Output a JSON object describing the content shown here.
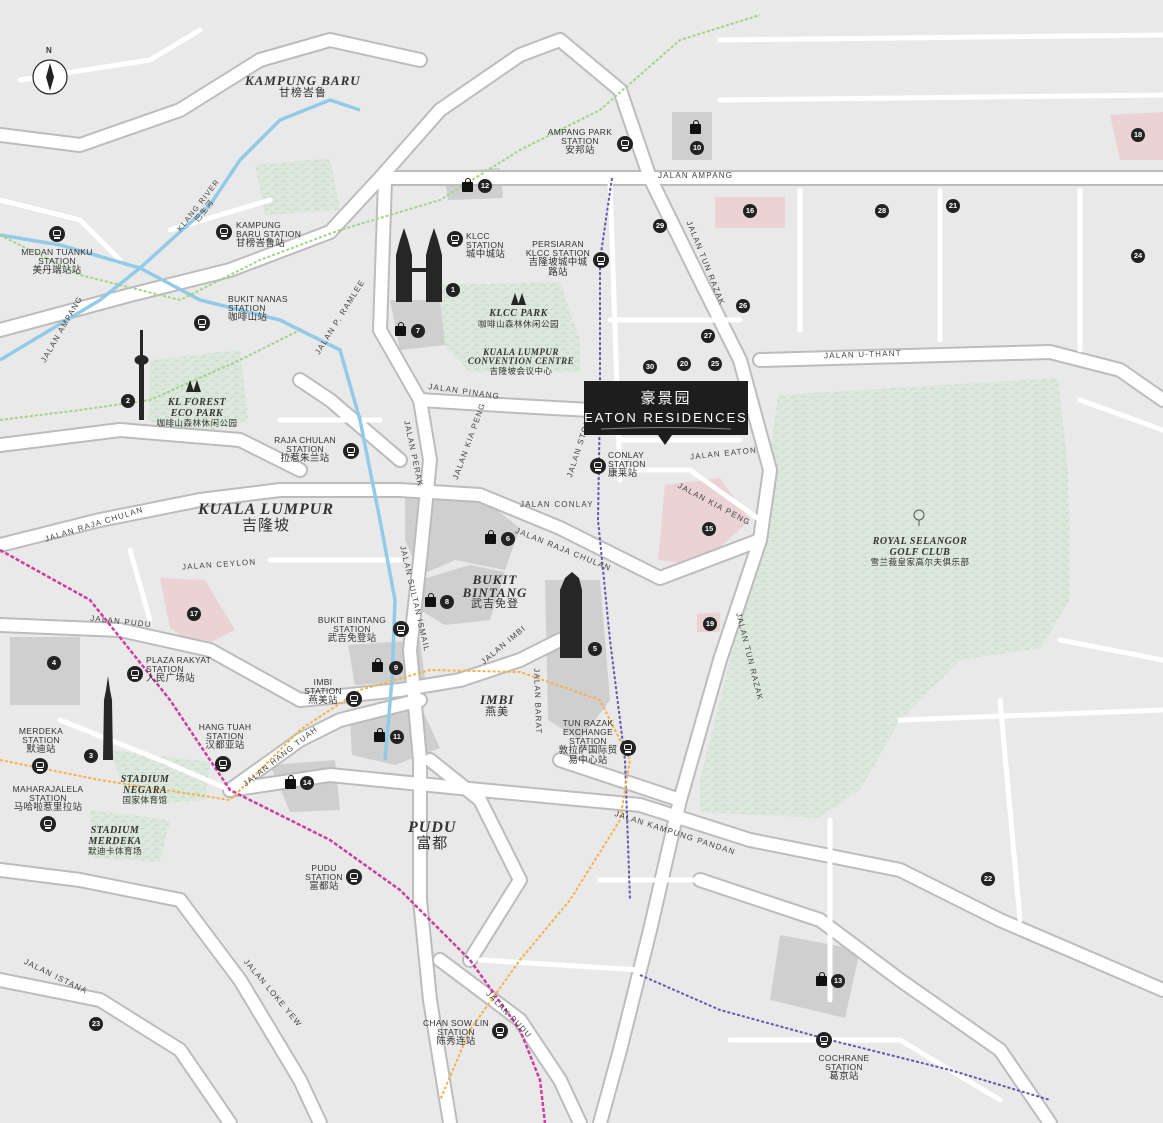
{
  "colors": {
    "background": "#e9e9e9",
    "road": "#ffffff",
    "road_edge": "#bcbcbc",
    "park": "#dde8dd",
    "building": "#cfcfcf",
    "highlight": "#ead2d5",
    "river": "#92cbe8",
    "line_magenta": "#cc3d9f",
    "line_purple": "#6258ad",
    "line_orange": "#f2b24d",
    "line_green": "#a4d28a",
    "landmark": "#262626"
  },
  "compass": {
    "label": "N",
    "icon": "compass-icon"
  },
  "eaton": {
    "cn": "豪景园",
    "en": "EATON RESIDENCES"
  },
  "districts": {
    "kampung_baru": {
      "en": "KAMPUNG BARU",
      "cn": "甘榜峇鲁"
    },
    "kuala_lumpur": {
      "en": "KUALA LUMPUR",
      "cn": "吉隆坡"
    },
    "bukit_bintang": {
      "en": "BUKIT BINTANG",
      "cn": "武吉免登"
    },
    "imbi": {
      "en": "IMBI",
      "cn": "燕美"
    },
    "pudu": {
      "en": "PUDU",
      "cn": "富都"
    }
  },
  "places": {
    "klcc_park": {
      "en": "KLCC PARK",
      "cn": "咖啡山森林休闲公园"
    },
    "klcc_convention": {
      "en": "KUALA LUMPUR CONVENTION CENTRE",
      "cn": "吉隆坡会议中心"
    },
    "kl_forest": {
      "en": "KL FOREST ECO PARK",
      "cn": "咖啡山森林休闲公园"
    },
    "royal_selangor": {
      "en": "ROYAL SELANGOR GOLF CLUB",
      "cn": "雪兰莪皇家高尔夫俱乐部"
    },
    "stadium_negara": {
      "en": "STADIUM NEGARA",
      "cn": "国家体育馆"
    },
    "stadium_merdeka": {
      "en": "STADIUM MERDEKA",
      "cn": "默迪卡体育场"
    }
  },
  "stations": {
    "ampang_park": {
      "en": "AMPANG PARK STATION",
      "cn": "安邦站"
    },
    "klcc": {
      "en": "KLCC STATION",
      "cn": "城中城站"
    },
    "persiaran_klcc": {
      "en": "PERSIARAN KLCC STATION",
      "cn": "吉隆坡城中城路站"
    },
    "kampung_baru": {
      "en": "KAMPUNG BARU STATION",
      "cn": "甘榜峇鲁站"
    },
    "medan_tuanku": {
      "en": "MEDAN TUANKU STATION",
      "cn": "美丹端站站"
    },
    "bukit_nanas": {
      "en": "BUKIT NANAS STATION",
      "cn": "咖啡山站"
    },
    "raja_chulan": {
      "en": "RAJA CHULAN STATION",
      "cn": "拉惹朱兰站"
    },
    "conlay": {
      "en": "CONLAY STATION",
      "cn": "康莱站"
    },
    "bukit_bintang": {
      "en": "BUKIT BINTANG STATION",
      "cn": "武吉免登站"
    },
    "plaza_rakyat": {
      "en": "PLAZA RAKYAT STATION",
      "cn": "人民广场站"
    },
    "imbi": {
      "en": "IMBI STATION",
      "cn": "燕美站"
    },
    "hang_tuah": {
      "en": "HANG TUAH STATION",
      "cn": "汉都亚站"
    },
    "merdeka": {
      "en": "MERDEKA STATION",
      "cn": "默迪站"
    },
    "maharajalela": {
      "en": "MAHARAJALELA STATION",
      "cn": "马哈啦惹里拉站"
    },
    "tun_razak": {
      "en": "TUN RAZAK EXCHANGE STATION",
      "cn": "敦拉萨国际贸易中心站"
    },
    "pudu": {
      "en": "PUDU STATION",
      "cn": "富都站"
    },
    "chan_sow_lin": {
      "en": "CHAN SOW LIN STATION",
      "cn": "陈秀连站"
    },
    "cochrane": {
      "en": "COCHRANE STATION",
      "cn": "葛京站"
    }
  },
  "roads": {
    "jalan_ampang": "JALAN AMPANG",
    "jalan_ampang_w": "JALAN AMPANG",
    "jalan_tun_razak_n": "JALAN TUN RAZAK",
    "jalan_tun_razak_s": "JALAN TUN RAZAK",
    "jalan_u_thant": "JALAN U-THANT",
    "jalan_p_ramlee": "JALAN P. RAMLEE",
    "jalan_pinang": "JALAN PINANG",
    "jalan_perak": "JALAN PERAK",
    "jalan_kia_peng_n": "JALAN KIA PENG",
    "jalan_kia_peng_e": "JALAN KIA PENG",
    "jalan_stonor": "JALAN STONOR",
    "jalan_eaton": "JALAN EATON",
    "jalan_conlay": "JALAN CONLAY",
    "jalan_raja_chulan_e": "JALAN RAJA CHULAN",
    "jalan_raja_chulan_w": "JALAN RAJA CHULAN",
    "jalan_ceylon": "JALAN CEYLON",
    "jalan_pudu": "JALAN PUDU",
    "jalan_sultan_ismail": "JALAN SULTAN ISMAIL",
    "jalan_imbi": "JALAN IMBI",
    "jalan_barat": "JALAN BARAT",
    "jalan_hang_tuah": "JALAN HANG TUAH",
    "jalan_kampung_pandan": "JALAN KAMPUNG PANDAN",
    "jalan_istana": "JALAN ISTANA",
    "jalan_loke_yew": "JALAN LOKE YEW",
    "jalan_pudu_s": "JALAN PUDU",
    "klang_river": "KLANG RIVER",
    "klang_river_cn": "巴生河"
  },
  "markers": [
    "1",
    "2",
    "3",
    "4",
    "5",
    "6",
    "7",
    "8",
    "9",
    "10",
    "11",
    "12",
    "13",
    "14",
    "15",
    "16",
    "17",
    "18",
    "19",
    "20",
    "21",
    "22",
    "23",
    "24",
    "25",
    "26",
    "27",
    "28",
    "29",
    "30"
  ]
}
